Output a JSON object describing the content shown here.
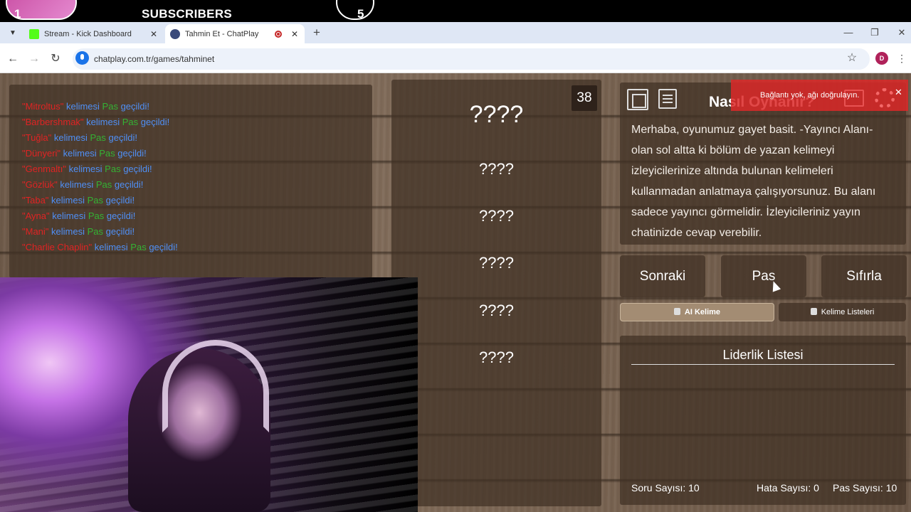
{
  "overlay": {
    "sub_count_left": "1",
    "label": "SUBSCRIBERS",
    "sub_count_right": "5"
  },
  "browser": {
    "tabs": [
      {
        "title": "Stream - Kick Dashboard",
        "favicon_color": "#53fc18"
      },
      {
        "title": "Tahmin Et - ChatPlay",
        "favicon_color": "#3a4a7a"
      }
    ],
    "url": "chatplay.com.tr/games/tahminet",
    "profile_initial": "D"
  },
  "chat": {
    "lines": [
      {
        "word": "\"Mitroltus\"",
        "mid": " kelimesi ",
        "pass": "Pas",
        "end": " geçildi!"
      },
      {
        "word": "\"Barbershmak\"",
        "mid": " kelimesi ",
        "pass": "Pas",
        "end": " geçildi!"
      },
      {
        "word": "\"Tuğla\"",
        "mid": " kelimesi ",
        "pass": "Pas",
        "end": " geçildi!"
      },
      {
        "word": "\"Dünyeri\"",
        "mid": " kelimesi ",
        "pass": "Pas",
        "end": " geçildi!"
      },
      {
        "word": "\"Genmaltı\"",
        "mid": " kelimesi ",
        "pass": "Pas",
        "end": " geçildi!"
      },
      {
        "word": "\"Gözlük\"",
        "mid": " kelimesi ",
        "pass": "Pas",
        "end": " geçildi!"
      },
      {
        "word": "\"Taba\"",
        "mid": " kelimesi ",
        "pass": "Pas",
        "end": " geçildi!"
      },
      {
        "word": "\"Ayna\"",
        "mid": " kelimesi ",
        "pass": "Pas",
        "end": " geçildi!"
      },
      {
        "word": "\"Mani\"",
        "mid": " kelimesi ",
        "pass": "Pas",
        "end": " geçildi!"
      },
      {
        "word": "\"Charlie Chaplin\"",
        "mid": " kelimesi ",
        "pass": "Pas",
        "end": " geçildi!"
      }
    ]
  },
  "game": {
    "timer": "38",
    "main_word": "????",
    "hidden_words": [
      "????",
      "????",
      "????",
      "????",
      "????"
    ]
  },
  "howto": {
    "title": "Nasıl Oynanır?",
    "text": "Merhaba, oyunumuz gayet basit. -Yayıncı Alanı- olan sol altta ki bölüm de yazan kelimeyi izleyicilerinize altında bulunan kelimeleri kullanmadan anlatmaya çalışıyorsunuz. Bu alanı sadece yayıncı görmelidir. İzleyicileriniz yayın chatinizde cevap verebilir."
  },
  "alert": {
    "text": "Bağlantı yok, ağı doğrulayın."
  },
  "actions": {
    "next": "Sonraki",
    "pass": "Pas",
    "reset": "Sıfırla",
    "ai_word": "AI Kelime",
    "word_lists": "Kelime Listeleri"
  },
  "leaderboard": {
    "title": "Liderlik Listesi",
    "question_count": "Soru Sayısı: 10",
    "error_count": "Hata Sayısı: 0",
    "pass_count": "Pas Sayısı: 10"
  }
}
